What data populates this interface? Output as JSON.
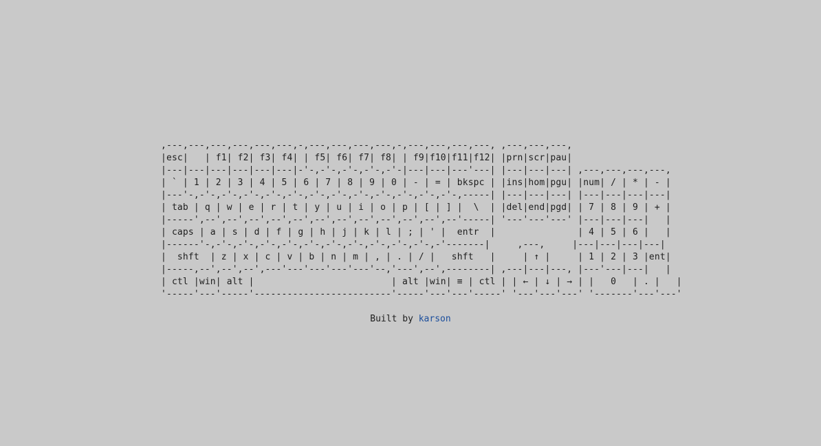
{
  "keyboard": {
    "lines": [
      ",---,---,---,---,---,---,-,---,---,---,---,-,---,---,---,---, ,---,---,---,",
      "|esc|   | f1| f2| f3| f4| | f5| f6| f7| f8| | f9|f10|f11|f12| |prn|scr|pau|",
      "|---|---|---|---|---|---|-'-,-'-,-'-,-'-,-'-|---|---|---'---| |---|---|---| ,---,---,---,---,",
      "| ` | 1 | 2 | 3 | 4 | 5 | 6 | 7 | 8 | 9 | 0 | - | = | bkspc | |ins|hom|pgu| |num| / | * | - |",
      "|---'-,-'-,-'-,-'-,-'-,-'-,-'-,-'-,-'-,-'-,-'-,-'-,-'-,-----| |---|---|---| |---|---|---|---|",
      "| tab | q | w | e | r | t | y | u | i | o | p | [ | ] |  \\  | |del|end|pgd| | 7 | 8 | 9 | + |",
      "|-----',--',--',--',--',--',--',--',--',--',--',--',--'-----| '---'---'---' |---|---|---|   |",
      "| caps | a | s | d | f | g | h | j | k | l | ; | ' |  entr  |               | 4 | 5 | 6 |   |",
      "|------'-,-'-,-'-,-'-,-'-,-'-,-'-,-'-,-'-,-'-,-'-,-'-------|     ,---,     |---|---|---|---|",
      "|  shft  | z | x | c | v | b | n | m | , | . | / |   shft   |     | ↑ |     | 1 | 2 | 3 |ent|",
      "|-----,--',--',--',---'---'---'---'---'--,'---',--',--------| ,---|---|---, |---'---|---|   |",
      "| ctl |win| alt |                         | alt |win| ≡ | ctl | | ← | ↓ | → | |   0   | . |   |",
      "'-----'---'-----'-------------------------'-----'---'---'-----' '---'---'---' '-------'---'---'"
    ]
  },
  "footer": {
    "prefix": "Built by ",
    "link_label": "karson"
  }
}
